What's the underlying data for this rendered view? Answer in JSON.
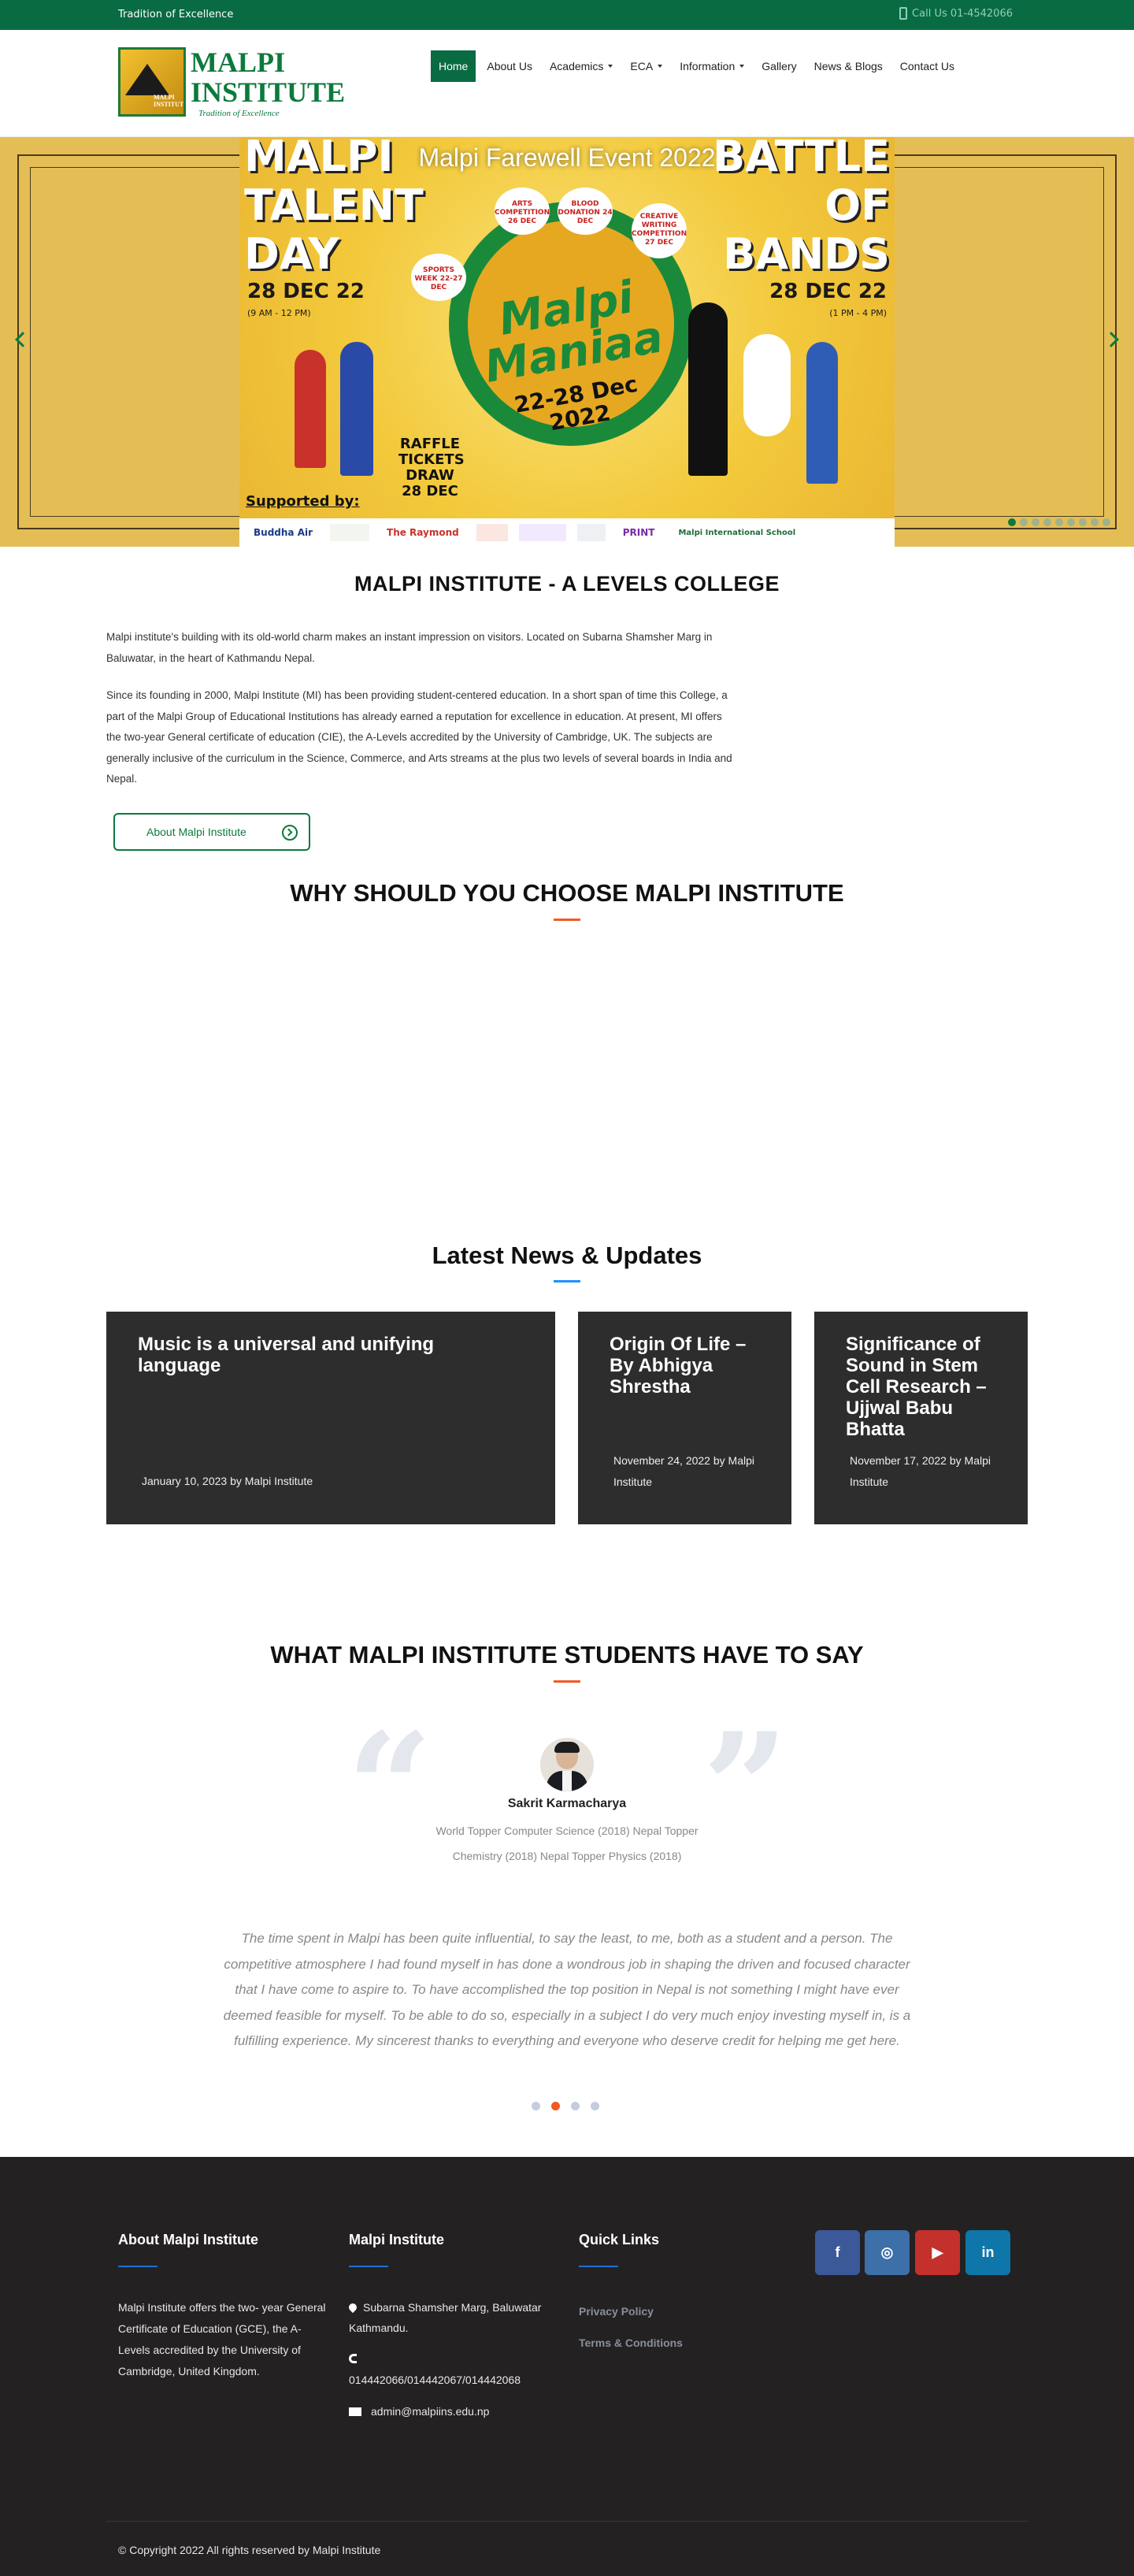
{
  "topbar": {
    "tagline": "Tradition of Excellence",
    "phone": "Call Us 01-4542066"
  },
  "logo": {
    "line1": "MALPI",
    "line2": "INSTITUTE",
    "tagline": "Tradition of Excellence",
    "emblem_text": "MALPI INSTITUTE"
  },
  "nav": {
    "items": [
      {
        "label": "Home",
        "active": true
      },
      {
        "label": "About Us"
      },
      {
        "label": "Academics",
        "dropdown": true
      },
      {
        "label": "ECA",
        "dropdown": true
      },
      {
        "label": "Information",
        "dropdown": true
      },
      {
        "label": "Gallery"
      },
      {
        "label": "News & Blogs"
      },
      {
        "label": "Contact Us"
      }
    ]
  },
  "hero": {
    "slide_title": "Malpi Farewell Event 2022",
    "left_big": "MALPI TALENT DAY",
    "left_date": "28 DEC 22",
    "left_time": "(9 AM - 12 PM)",
    "right_big": "BATTLE OF BANDS",
    "right_date": "28 DEC 22",
    "right_time": "(1 PM - 4 PM)",
    "center_name": "Malpi Maniaa",
    "center_dates": "22-28 Dec 2022",
    "bubbles": [
      "ARTS COMPETITION 26 DEC",
      "BLOOD DONATION 24 DEC",
      "CREATIVE WRITING COMPETITION 27 DEC",
      "SPORTS WEEK 22-27 DEC"
    ],
    "raffle": "RAFFLE TICKETS DRAW 28 DEC",
    "supported_by": "Supported by:",
    "sponsors": [
      "Buddha Air",
      "",
      "The Raymond",
      "",
      "",
      "",
      "PRINT",
      "Malpi International School"
    ],
    "total_slides": 9,
    "active_slide": 1
  },
  "about": {
    "title": "MALPI INSTITUTE - A LEVELS COLLEGE",
    "p1": "Malpi institute's building with its old-world charm makes an instant impression on visitors. Located on Subarna Shamsher Marg in Baluwatar, in the heart of Kathmandu Nepal.",
    "p2": "Since its founding in 2000, Malpi Institute (MI) has been providing student-centered education. In a short span of time this College, a part of the Malpi Group of Educational Institutions has already earned a reputation for excellence in education. At present, MI offers the two-year General certificate of education (CIE), the A-Levels accredited by the University of Cambridge, UK. The subjects are generally inclusive of the curriculum in the Science, Commerce, and Arts streams at the plus two levels of several boards in India and Nepal.",
    "button": "About Malpi Institute"
  },
  "why": {
    "title": "WHY SHOULD YOU CHOOSE MALPI INSTITUTE",
    "accent": "#f05a23"
  },
  "news": {
    "title": "Latest News & Updates",
    "accent": "#1e90ff",
    "cards": [
      {
        "title": "Music is a universal and unifying language",
        "meta": "January 10, 2023 by Malpi Institute"
      },
      {
        "title": "Origin Of Life – By Abhigya Shrestha",
        "meta": "November 24, 2022 by Malpi Institute"
      },
      {
        "title": "Significance of Sound in Stem Cell Research – Ujjwal Babu Bhatta",
        "meta": "November 17, 2022 by Malpi Institute"
      }
    ]
  },
  "testimonials": {
    "title": "WHAT MALPI INSTITUTE STUDENTS HAVE TO SAY",
    "name": "Sakrit Karmacharya",
    "role": "World Topper Computer Science (2018) Nepal Topper Chemistry (2018) Nepal Topper Physics (2018)",
    "quote": "The time spent in Malpi has been quite influential, to say the least, to me, both as a student and a person. The competitive atmosphere I had found myself in has done a wondrous job in shaping the driven and focused character that I have come to aspire to. To have accomplished the top position in Nepal is not something I might have ever deemed feasible for myself. To be able to do so, especially in a subject I do very much enjoy investing myself in, is a fulfilling experience. My sincerest thanks to everything and everyone who deserve credit for helping me get here.",
    "dots": 4,
    "active_dot": 2
  },
  "footer": {
    "about_head": "About Malpi Institute",
    "about_text": "Malpi Institute offers the two- year General Certificate of Education (GCE), the A- Levels accredited by the University of Cambridge, United Kingdom.",
    "contact_head": "Malpi Institute",
    "address": "Subarna Shamsher Marg, Baluwatar Kathmandu.",
    "phones": "014442066/014442067/014442068",
    "email": "admin@malpiins.edu.np",
    "links_head": "Quick Links",
    "links": [
      "Privacy Policy",
      "Terms & Conditions"
    ],
    "social": [
      {
        "name": "facebook",
        "glyph": "f",
        "color": "#3b5998"
      },
      {
        "name": "instagram",
        "glyph": "◎",
        "color": "#3d6fa8"
      },
      {
        "name": "youtube",
        "glyph": "▶",
        "color": "#c4302b"
      },
      {
        "name": "linkedin",
        "glyph": "in",
        "color": "#0e76a8"
      }
    ],
    "copyright": "© Copyright 2022 All rights reserved by Malpi Institute"
  }
}
